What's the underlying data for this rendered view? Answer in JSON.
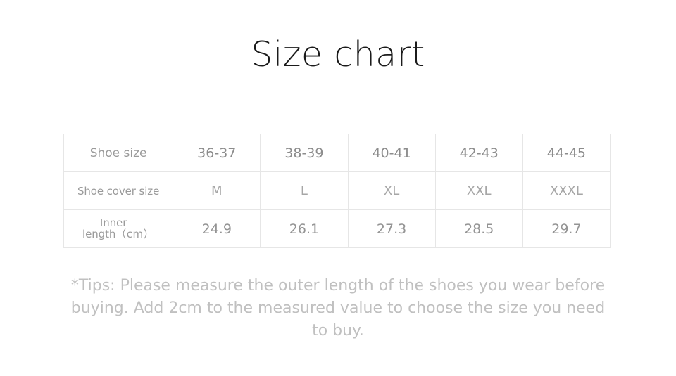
{
  "page": {
    "title": "Size chart",
    "background_color": "#ffffff",
    "title_color": "#1b1b1b",
    "table_border_color": "#e6e6e6",
    "label_text_color": "#9a9a9a",
    "value_text_color": "#8c8c8c",
    "tips_text_color": "#c0c0c0"
  },
  "table": {
    "rows": [
      {
        "label": "Shoe size",
        "values": [
          "36-37",
          "38-39",
          "40-41",
          "42-43",
          "44-45"
        ]
      },
      {
        "label": "Shoe cover size",
        "values": [
          "M",
          "L",
          "XL",
          "XXL",
          "XXXL"
        ]
      },
      {
        "label_line1": "Inner",
        "label_line2_text": "length",
        "label_line2_unit": "（cm）",
        "label": "Inner length（cm）",
        "values": [
          "24.9",
          "26.1",
          "27.3",
          "28.5",
          "29.7"
        ]
      }
    ]
  },
  "tips": {
    "line1": "*Tips: Please measure the outer length of the shoes you wear before",
    "line2": "buying. Add 2cm to the measured value to choose the size you need",
    "line3": "to buy."
  }
}
